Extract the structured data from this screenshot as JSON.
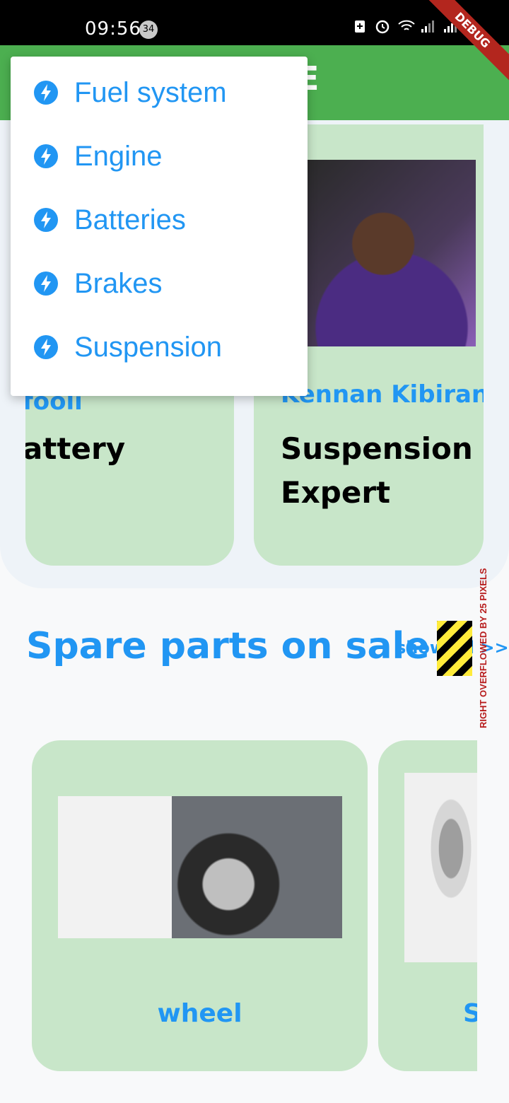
{
  "status_bar": {
    "time": "09:56",
    "notification_count": "34",
    "icons": [
      "battery-saver-icon",
      "alarm-icon",
      "wifi-icon",
      "signal-icon",
      "signal-icon",
      "battery-icon"
    ]
  },
  "debug_banner": "DEBUG",
  "app_bar": {
    "title_fragment": "E",
    "color": "#4caf50"
  },
  "experts": [
    {
      "name": "fooli",
      "title": "attery"
    },
    {
      "name": "Kennan Kibiran",
      "title_lines": [
        "Suspension",
        "Expert"
      ]
    }
  ],
  "spare_parts": {
    "title": "Spare parts on sale",
    "show_all": "show all >>",
    "overflow_warning": "RIGHT OVERFLOWED BY 25 PIXELS",
    "items": [
      {
        "label": "wheel"
      },
      {
        "label": "S"
      }
    ]
  },
  "menu": {
    "items": [
      {
        "label": "Fuel system",
        "icon": "bolt-icon"
      },
      {
        "label": "Engine",
        "icon": "bolt-icon"
      },
      {
        "label": "Batteries",
        "icon": "bolt-icon"
      },
      {
        "label": "Brakes",
        "icon": "bolt-icon"
      },
      {
        "label": "Suspension",
        "icon": "bolt-icon"
      }
    ]
  },
  "colors": {
    "accent": "#2196f3",
    "card_bg": "#c8e6c9"
  }
}
